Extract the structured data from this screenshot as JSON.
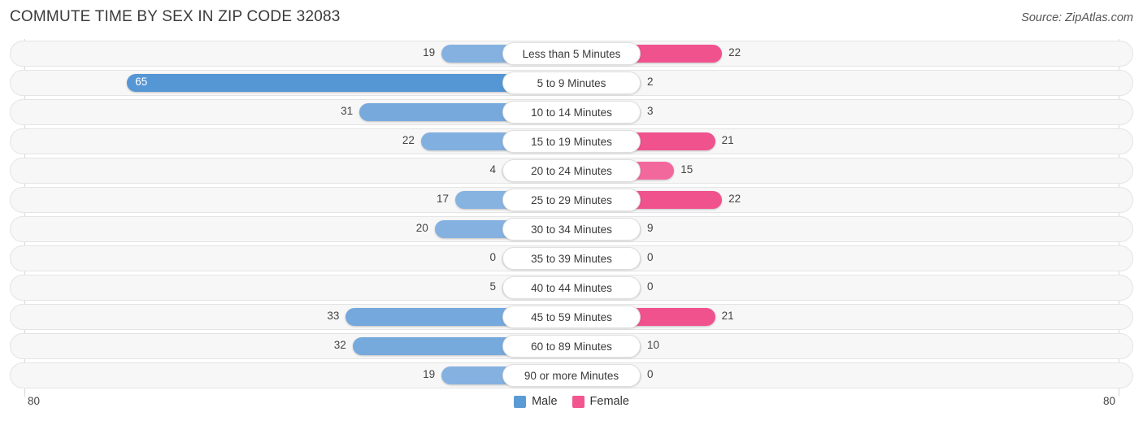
{
  "header": {
    "title": "COMMUTE TIME BY SEX IN ZIP CODE 32083",
    "source": "Source: ZipAtlas.com"
  },
  "legend": {
    "male_label": "Male",
    "female_label": "Female",
    "male_color": "#5b9bd5",
    "female_color": "#f2568f"
  },
  "axis": {
    "left_label": "80",
    "right_label": "80",
    "max": 80
  },
  "chart_data": {
    "type": "bar",
    "subtype": "diverging-bidirectional",
    "title": "COMMUTE TIME BY SEX IN ZIP CODE 32083",
    "xlabel": "",
    "ylabel": "",
    "xlim": [
      -80,
      80
    ],
    "grid": true,
    "legend_position": "bottom-center",
    "categories": [
      "Less than 5 Minutes",
      "5 to 9 Minutes",
      "10 to 14 Minutes",
      "15 to 19 Minutes",
      "20 to 24 Minutes",
      "25 to 29 Minutes",
      "30 to 34 Minutes",
      "35 to 39 Minutes",
      "40 to 44 Minutes",
      "45 to 59 Minutes",
      "60 to 89 Minutes",
      "90 or more Minutes"
    ],
    "series": [
      {
        "name": "Male",
        "direction": "left",
        "color": "#5b9bd5",
        "values": [
          19,
          65,
          31,
          22,
          4,
          17,
          20,
          0,
          5,
          33,
          32,
          19
        ]
      },
      {
        "name": "Female",
        "direction": "right",
        "color": "#f2568f",
        "values": [
          22,
          2,
          3,
          21,
          15,
          22,
          9,
          0,
          0,
          21,
          10,
          0
        ]
      }
    ]
  }
}
